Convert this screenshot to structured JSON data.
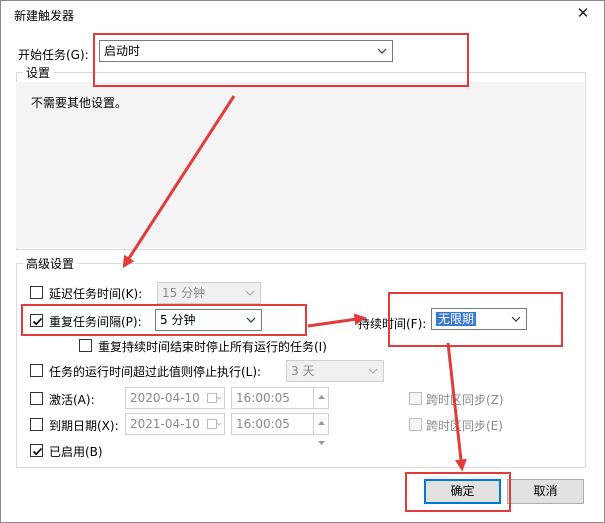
{
  "window": {
    "title": "新建触发器",
    "close_glyph": "✕"
  },
  "begin_task": {
    "label": "开始任务(G):",
    "value": "启动时"
  },
  "settings": {
    "group_title": "设置",
    "message": "不需要其他设置。"
  },
  "advanced": {
    "group_title": "高级设置",
    "delay": {
      "label": "延迟任务时间(K):",
      "value": "15 分钟",
      "checked": false
    },
    "repeat": {
      "label": "重复任务间隔(P):",
      "value": "5 分钟",
      "checked": true
    },
    "duration": {
      "label": "持续时间(F):",
      "value": "无限期"
    },
    "stop_all": {
      "label": "重复持续时间结束时停止所有运行的任务(I)",
      "checked": false
    },
    "stop_longer": {
      "label": "任务的运行时间超过此值则停止执行(L):",
      "value": "3 天",
      "checked": false
    },
    "activate": {
      "label": "激活(A):",
      "date": "2020-04-10",
      "time": "16:00:05",
      "sync_label": "跨时区同步(Z)",
      "checked": false
    },
    "expire": {
      "label": "到期日期(X):",
      "date": "2021-04-10",
      "time": "16:00:05",
      "sync_label": "跨时区同步(E)",
      "checked": false
    },
    "enabled": {
      "label": "已启用(B)",
      "checked": true
    }
  },
  "buttons": {
    "ok": "确定",
    "cancel": "取消"
  },
  "annotation_colors": {
    "red": "#e43a3a"
  },
  "icons": [
    "close-icon",
    "chevron-down-icon",
    "check-icon",
    "calendar-icon",
    "spin-up-icon",
    "spin-down-icon"
  ]
}
